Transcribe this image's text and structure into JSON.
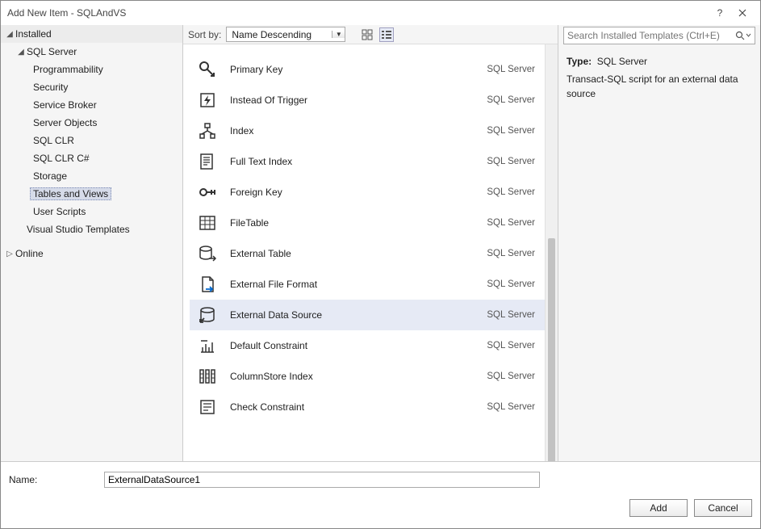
{
  "window": {
    "title": "Add New Item - SQLAndVS"
  },
  "left": {
    "installed": "Installed",
    "sqlserver": "SQL Server",
    "online": "Online",
    "categories": [
      "Programmability",
      "Security",
      "Service Broker",
      "Server Objects",
      "SQL CLR",
      "SQL CLR C#",
      "Storage",
      "Tables and Views",
      "User Scripts"
    ],
    "vstemplates": "Visual Studio Templates",
    "selected": "Tables and Views"
  },
  "toolbar": {
    "sort_label": "Sort by:",
    "sort_value": "Name Descending"
  },
  "templates": [
    {
      "name": "Primary Key",
      "category": "SQL Server",
      "icon": "primary-key"
    },
    {
      "name": "Instead Of Trigger",
      "category": "SQL Server",
      "icon": "trigger"
    },
    {
      "name": "Index",
      "category": "SQL Server",
      "icon": "index"
    },
    {
      "name": "Full Text Index",
      "category": "SQL Server",
      "icon": "fulltext"
    },
    {
      "name": "Foreign Key",
      "category": "SQL Server",
      "icon": "foreign-key"
    },
    {
      "name": "FileTable",
      "category": "SQL Server",
      "icon": "filetable"
    },
    {
      "name": "External Table",
      "category": "SQL Server",
      "icon": "externaltable"
    },
    {
      "name": "External File Format",
      "category": "SQL Server",
      "icon": "fileformat"
    },
    {
      "name": "External Data Source",
      "category": "SQL Server",
      "icon": "datasource",
      "selected": true
    },
    {
      "name": "Default Constraint",
      "category": "SQL Server",
      "icon": "constraint"
    },
    {
      "name": "ColumnStore Index",
      "category": "SQL Server",
      "icon": "columnstore"
    },
    {
      "name": "Check Constraint",
      "category": "SQL Server",
      "icon": "check"
    }
  ],
  "search": {
    "placeholder": "Search Installed Templates (Ctrl+E)"
  },
  "info": {
    "type_label": "Type:",
    "type_value": "SQL Server",
    "description": "Transact-SQL script for an external data source"
  },
  "footer": {
    "name_label": "Name:",
    "name_value": "ExternalDataSource1",
    "add": "Add",
    "cancel": "Cancel"
  }
}
